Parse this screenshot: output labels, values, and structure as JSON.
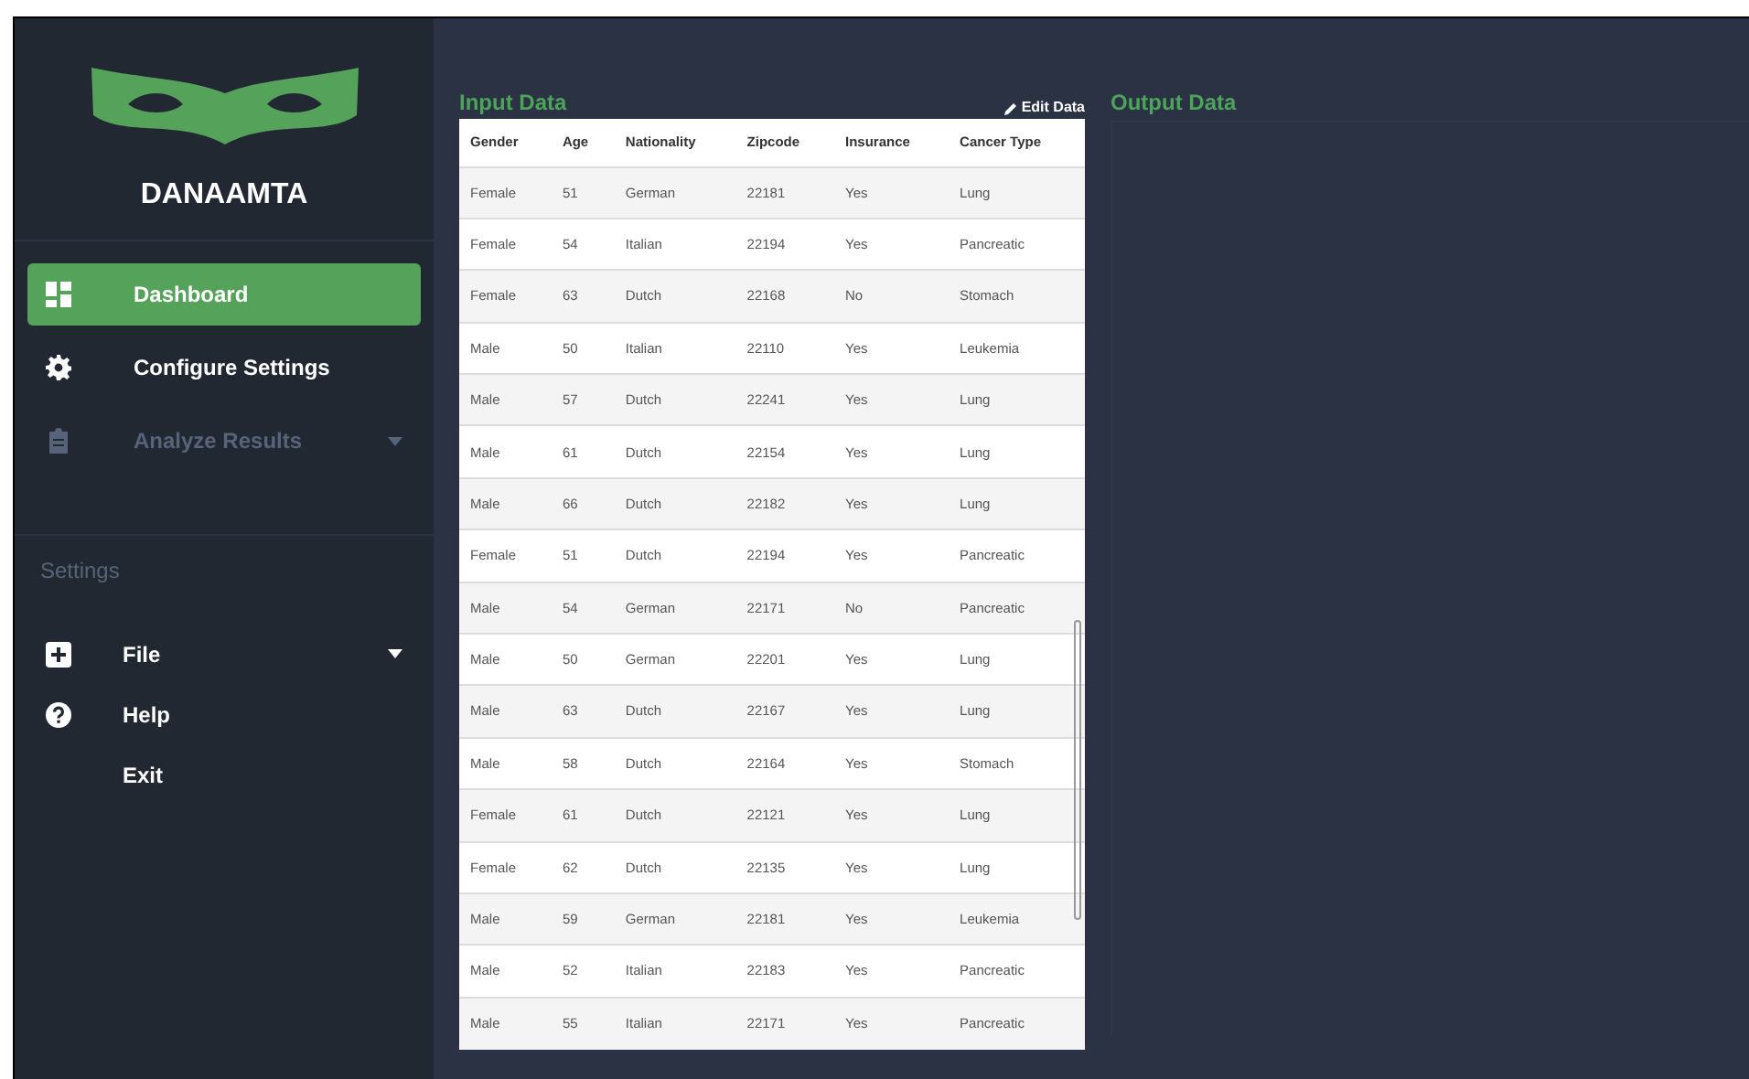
{
  "brand": {
    "name": "DANAAMTA"
  },
  "nav": [
    {
      "label": "Dashboard",
      "selected": true,
      "disabled": false,
      "has_caret": false
    },
    {
      "label": "Configure Settings",
      "selected": false,
      "disabled": false,
      "has_caret": false
    },
    {
      "label": "Analyze Results",
      "selected": false,
      "disabled": true,
      "has_caret": true
    }
  ],
  "settings_section": {
    "title": "Settings",
    "items": [
      {
        "label": "File",
        "has_caret": true
      },
      {
        "label": "Help",
        "has_caret": false
      },
      {
        "label": "Exit",
        "has_caret": false
      }
    ]
  },
  "input_panel": {
    "title": "Input Data",
    "edit_link": "Edit Data",
    "table": {
      "columns": [
        "Gender",
        "Age",
        "Nationality",
        "Zipcode",
        "Insurance",
        "Cancer Type"
      ],
      "rows": [
        [
          "Female",
          "51",
          "German",
          "22181",
          "Yes",
          "Lung"
        ],
        [
          "Female",
          "54",
          "Italian",
          "22194",
          "Yes",
          "Pancreatic"
        ],
        [
          "Female",
          "63",
          "Dutch",
          "22168",
          "No",
          "Stomach"
        ],
        [
          "Male",
          "50",
          "Italian",
          "22110",
          "Yes",
          "Leukemia"
        ],
        [
          "Male",
          "57",
          "Dutch",
          "22241",
          "Yes",
          "Lung"
        ],
        [
          "Male",
          "61",
          "Dutch",
          "22154",
          "Yes",
          "Lung"
        ],
        [
          "Male",
          "66",
          "Dutch",
          "22182",
          "Yes",
          "Lung"
        ],
        [
          "Female",
          "51",
          "Dutch",
          "22194",
          "Yes",
          "Pancreatic"
        ],
        [
          "Male",
          "54",
          "German",
          "22171",
          "No",
          "Pancreatic"
        ],
        [
          "Male",
          "50",
          "German",
          "22201",
          "Yes",
          "Lung"
        ],
        [
          "Male",
          "63",
          "Dutch",
          "22167",
          "Yes",
          "Lung"
        ],
        [
          "Male",
          "58",
          "Dutch",
          "22164",
          "Yes",
          "Stomach"
        ],
        [
          "Female",
          "61",
          "Dutch",
          "22121",
          "Yes",
          "Lung"
        ],
        [
          "Female",
          "62",
          "Dutch",
          "22135",
          "Yes",
          "Lung"
        ],
        [
          "Male",
          "59",
          "German",
          "22181",
          "Yes",
          "Leukemia"
        ],
        [
          "Male",
          "52",
          "Italian",
          "22183",
          "Yes",
          "Pancreatic"
        ],
        [
          "Male",
          "55",
          "Italian",
          "22171",
          "Yes",
          "Pancreatic"
        ]
      ]
    }
  },
  "output_panel": {
    "title": "Output Data"
  }
}
